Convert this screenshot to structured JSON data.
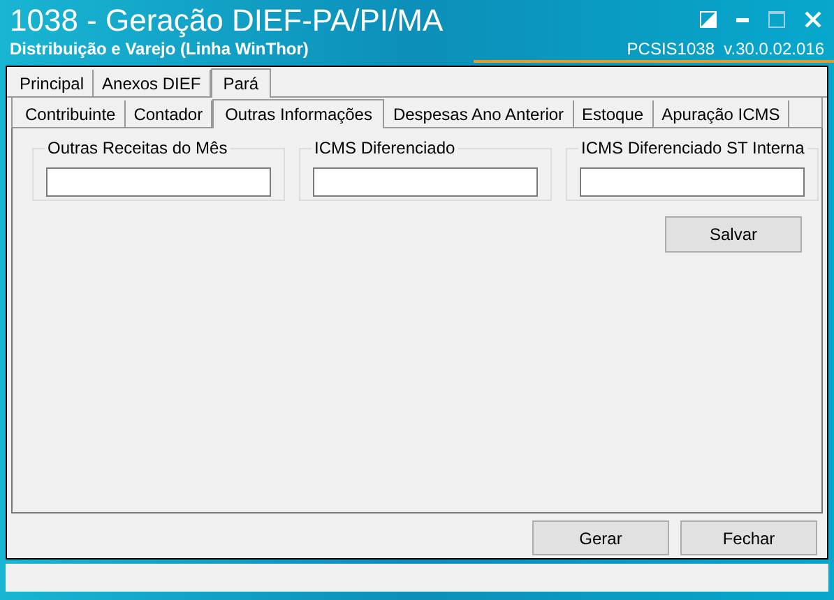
{
  "window": {
    "title": "1038 - Geração DIEF-PA/PI/MA",
    "subtitle": "Distribuição e Varejo (Linha WinThor)",
    "version": "PCSIS1038  v.30.0.02.016"
  },
  "tabs": [
    {
      "label": "Principal",
      "selected": false
    },
    {
      "label": "Anexos DIEF",
      "selected": false
    },
    {
      "label": "Pará",
      "selected": true
    }
  ],
  "subtabs": [
    {
      "label": "Contribuinte",
      "selected": false
    },
    {
      "label": "Contador",
      "selected": false
    },
    {
      "label": "Outras Informações",
      "selected": true
    },
    {
      "label": "Despesas Ano Anterior",
      "selected": false
    },
    {
      "label": "Estoque",
      "selected": false
    },
    {
      "label": "Apuração ICMS",
      "selected": false
    }
  ],
  "fields": [
    {
      "label": "Outras Receitas do Mês"
    },
    {
      "label": "ICMS Diferenciado"
    },
    {
      "label": "ICMS Diferenciado ST Interna"
    }
  ],
  "save_button": "Salvar",
  "buttons": [
    "Gerar",
    "Fechar"
  ]
}
